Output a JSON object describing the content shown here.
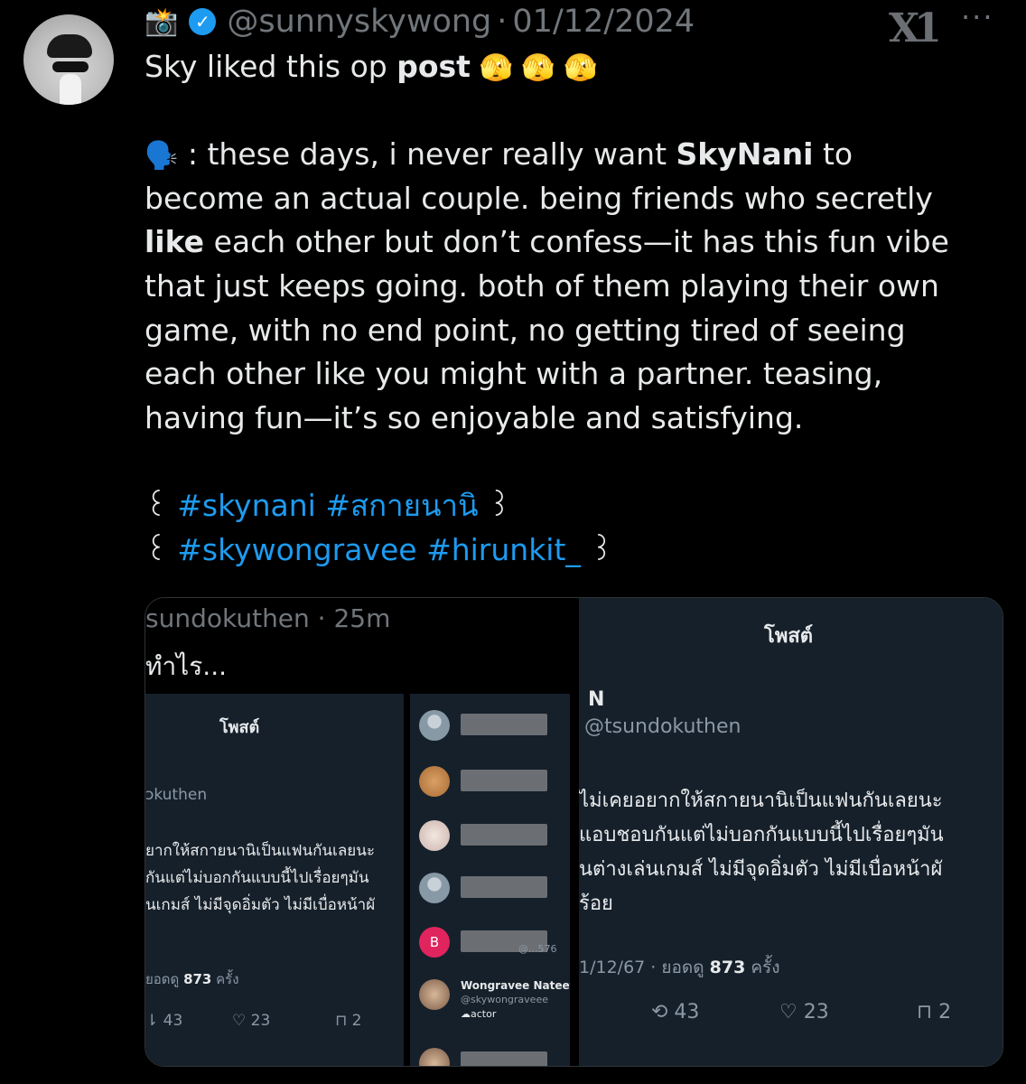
{
  "tweet": {
    "camera_icon": "📸",
    "handle": "@sunnyskywong",
    "sep": "·",
    "date": "01/12/2024",
    "logo_text": "X1",
    "more_label": "···",
    "line1_pre": "Sky liked this op ",
    "line1_bold": "post",
    "line1_emoji": " 🫣 🫣 🫣",
    "speaker_emoji": "🗣️",
    "p1": ": these days, i never really want ",
    "p1_bold": "SkyNani",
    "p1_end": " to",
    "p2": "become an actual couple. being friends who secretly",
    "p3_bold": "like",
    "p3": " each other but don’t confess—it has this fun vibe",
    "p4": "that just keeps going. both of them playing their own",
    "p5": "game, with no end point, no getting tired of seeing",
    "p6": "each other like you might with a partner. teasing,",
    "p7": "having fun—it’s so enjoyable and satisfying.",
    "tags1_open": "꒰ ",
    "tag1": "#skynani",
    "tag2": "#สกายนานิ",
    "tags1_close": " ꒱",
    "tags2_open": "꒰ ",
    "tag3": "#skywongravee",
    "tag4": "#hirunkit_",
    "tags2_close": " ꒱"
  },
  "media": {
    "left": {
      "meta": "sundokuthen · 25m",
      "text": "ทำไร...",
      "post_title": "โพสต์",
      "handle": "ɔkuthen",
      "l1": "ยากให้สกายนานิเป็นแฟนกันเลยนะ",
      "l2": "กันแต่ไม่บอกกันแบบนี้ไปเรื่อยๆมัน",
      "l3": "นเกมส์ ไม่มีจุดอิ่มตัว ไม่มีเบื่อหน้าผั",
      "views_pre": "ยอดดู ",
      "views_num": "873",
      "views_post": " ครั้ง",
      "rt": "⇂ 43",
      "like": "♡ 23",
      "bm": "⊓ 2"
    },
    "list": {
      "b_letter": "B",
      "b_handle": "@...576",
      "named_name": "Wongravee Nateeto",
      "named_handle": "@skywongraveee",
      "named_bio": "☁actor"
    },
    "right": {
      "post_title": "โพสต์",
      "name": "N",
      "handle": "@tsundokuthen",
      "l1": "ไม่เคยอยากให้สกายนานิเป็นแฟนกันเลยนะ",
      "l2": "แอบชอบกันแต่ไม่บอกกันแบบนี้ไปเรื่อยๆมัน",
      "l3": "นต่างเล่นเกมส์ ไม่มีจุดอิ่มตัว ไม่มีเบื่อหน้าผั",
      "l4": "ร้อย",
      "views_pre": "1/12/67 · ยอดดู ",
      "views_num": "873",
      "views_post": " ครั้ง",
      "rt": "⟲ 43",
      "like": "♡ 23",
      "bm": "⊓ 2"
    }
  },
  "colors": {
    "accent": "#1d9bf0",
    "muted": "#71767b",
    "panel": "#15202b"
  }
}
